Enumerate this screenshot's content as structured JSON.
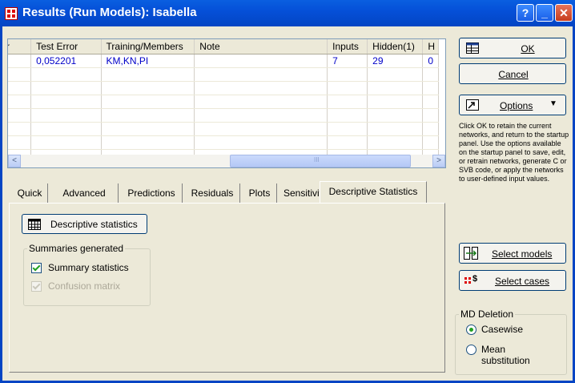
{
  "window": {
    "title": "Results (Run Models): Isabella",
    "help_label": "?",
    "minimize_label": "_",
    "close_label": "✕"
  },
  "grid": {
    "columns": [
      "r",
      "Test Error",
      "Training/Members",
      "Note",
      "Inputs",
      "Hidden(1)",
      "H"
    ],
    "rows": [
      [
        "",
        "0,052201",
        "KM,KN,PI",
        "",
        "7",
        "29",
        "0"
      ]
    ]
  },
  "scrollbar": {
    "left_arrow": "<",
    "right_arrow": ">",
    "thumb_grip": "III"
  },
  "tabs": [
    "Quick",
    "Advanced",
    "Predictions",
    "Residuals",
    "Plots",
    "Sensitivity",
    "Descriptive Statistics"
  ],
  "active_tab": "Descriptive Statistics",
  "panel": {
    "descriptive_button": "Descriptive statistics",
    "summaries_group": "Summaries generated",
    "summary_statistics": "Summary statistics",
    "confusion_matrix": "Confusion matrix"
  },
  "side": {
    "ok_label": "OK",
    "cancel_label": "Cancel",
    "options_label": "Options",
    "description": "Click OK to retain the current networks, and return to the startup panel. Use the options available on the startup panel to save, edit, or retrain networks, generate C or SVB code, or apply the networks to user-defined input values.",
    "select_models": "Select models",
    "select_cases": "Select cases",
    "md_group": "MD Deletion",
    "casewise": "Casewise",
    "mean_substitution": "Mean substitution"
  },
  "colors": {
    "title_bar": "#0445c4",
    "close_button": "#c73c1c",
    "cell_text": "#0000c8",
    "check_mark": "#21a121"
  }
}
